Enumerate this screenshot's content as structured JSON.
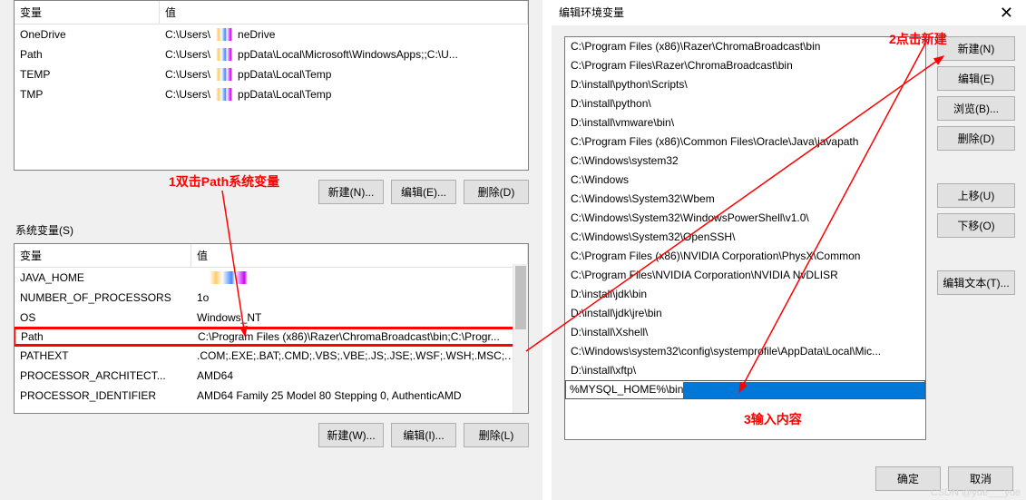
{
  "left": {
    "user_vars_header_var": "变量",
    "user_vars_header_val": "值",
    "user_vars": [
      {
        "name": "OneDrive",
        "value_prefix": "C:\\Users\\",
        "value_suffix": "neDrive"
      },
      {
        "name": "Path",
        "value_prefix": "C:\\Users\\",
        "value_suffix": "ppData\\Local\\Microsoft\\WindowsApps;;C:\\U..."
      },
      {
        "name": "TEMP",
        "value_prefix": "C:\\Users\\",
        "value_suffix": "ppData\\Local\\Temp"
      },
      {
        "name": "TMP",
        "value_prefix": "C:\\Users\\",
        "value_suffix": "ppData\\Local\\Temp"
      }
    ],
    "btn_new_n": "新建(N)...",
    "btn_edit_e": "编辑(E)...",
    "btn_del_d": "删除(D)",
    "sys_label": "系统变量(S)",
    "sys_vars_header_var": "变量",
    "sys_vars_header_val": "值",
    "sys_vars": [
      {
        "name": "JAVA_HOME",
        "value": ""
      },
      {
        "name": "NUMBER_OF_PROCESSORS",
        "value": "1o"
      },
      {
        "name": "OS",
        "value": "Windows_NT"
      },
      {
        "name": "Path",
        "value": "C:\\Program Files (x86)\\Razer\\ChromaBroadcast\\bin;C:\\Progr...",
        "highlight": true
      },
      {
        "name": "PATHEXT",
        "value": ".COM;.EXE;.BAT;.CMD;.VBS;.VBE;.JS;.JSE;.WSF;.WSH;.MSC;.PY;.P..."
      },
      {
        "name": "PROCESSOR_ARCHITECT...",
        "value": "AMD64"
      },
      {
        "name": "PROCESSOR_IDENTIFIER",
        "value": "AMD64 Family 25 Model 80 Stepping 0, AuthenticAMD"
      }
    ],
    "btn_new_w": "新建(W)...",
    "btn_edit_i": "编辑(I)...",
    "btn_del_l": "删除(L)"
  },
  "right": {
    "title": "编辑环境变量",
    "paths": [
      "C:\\Program Files (x86)\\Razer\\ChromaBroadcast\\bin",
      "C:\\Program Files\\Razer\\ChromaBroadcast\\bin",
      "D:\\install\\python\\Scripts\\",
      "D:\\install\\python\\",
      "D:\\install\\vmware\\bin\\",
      "C:\\Program Files (x86)\\Common Files\\Oracle\\Java\\javapath",
      "C:\\Windows\\system32",
      "C:\\Windows",
      "C:\\Windows\\System32\\Wbem",
      "C:\\Windows\\System32\\WindowsPowerShell\\v1.0\\",
      "C:\\Windows\\System32\\OpenSSH\\",
      "C:\\Program Files (x86)\\NVIDIA Corporation\\PhysX\\Common",
      "C:\\Program Files\\NVIDIA Corporation\\NVIDIA NvDLISR",
      "D:\\install\\jdk\\bin",
      "D:\\install\\jdk\\jre\\bin",
      "D:\\install\\Xshell\\",
      "C:\\Windows\\system32\\config\\systemprofile\\AppData\\Local\\Mic...",
      "D:\\install\\xftp\\"
    ],
    "editing_value": "%MYSQL_HOME%\\bin",
    "btn_new": "新建(N)",
    "btn_edit": "编辑(E)",
    "btn_browse": "浏览(B)...",
    "btn_delete": "删除(D)",
    "btn_up": "上移(U)",
    "btn_down": "下移(O)",
    "btn_edit_text": "编辑文本(T)...",
    "btn_ok": "确定",
    "btn_cancel": "取消"
  },
  "annotations": {
    "a1": "1双击Path系统变量",
    "a2": "2点击新建",
    "a3": "3输入内容"
  },
  "watermark": "CSDN @yue___yue"
}
